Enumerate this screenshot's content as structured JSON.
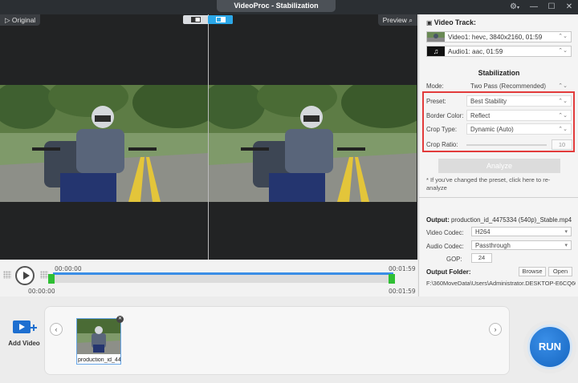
{
  "window": {
    "title": "VideoProc - Stabilization"
  },
  "preview": {
    "original_label": "Original",
    "preview_label": "Preview"
  },
  "timeline": {
    "time_start_top": "00:00:00",
    "time_start_bottom": "00:00:00",
    "time_end_top": "00:01:59",
    "time_end_bottom": "00:01:59"
  },
  "panel": {
    "video_track_heading": "Video Track:",
    "video_track_item": "Video1: hevc, 3840x2160, 01:59",
    "audio_track_item": "Audio1: aac, 01:59",
    "stabilization_heading": "Stabilization",
    "mode_label": "Mode:",
    "mode_value": "Two Pass (Recommended)",
    "preset_label": "Preset:",
    "preset_value": "Best Stability",
    "border_color_label": "Border Color:",
    "border_color_value": "Reflect",
    "crop_type_label": "Crop Type:",
    "crop_type_value": "Dynamic (Auto)",
    "crop_ratio_label": "Crop Ratio:",
    "crop_ratio_value": "10",
    "analyze_label": "Analyze",
    "note": "* If you've changed the preset, click here to re-analyze",
    "output_label": "Output:",
    "output_file": "production_id_4475334 (540p)_Stable.mp4",
    "video_codec_label": "Video Codec:",
    "video_codec_value": "H264",
    "audio_codec_label": "Audio Codec:",
    "audio_codec_value": "Passthrough",
    "gop_label": "GOP:",
    "gop_value": "24",
    "output_folder_label": "Output Folder:",
    "browse_label": "Browse",
    "open_label": "Open",
    "output_path": "F:\\360MoveData\\Users\\Administrator.DESKTOP-E6CQ60Q\\"
  },
  "bottom": {
    "add_video_label": "Add Video",
    "clip_name": "production_id_44",
    "run_label": "RUN"
  }
}
